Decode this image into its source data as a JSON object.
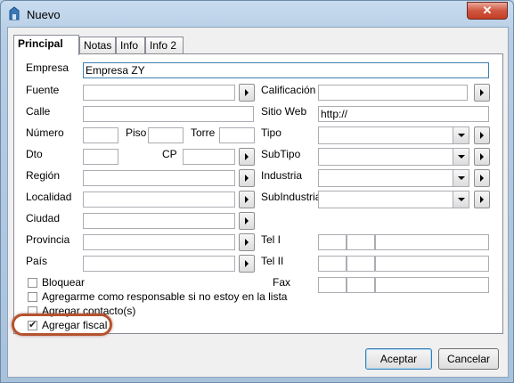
{
  "window": {
    "title": "Nuevo",
    "close_label": "✕"
  },
  "tabs": [
    {
      "label": "Principal"
    },
    {
      "label": "Notas"
    },
    {
      "label": "Info"
    },
    {
      "label": "Info 2"
    }
  ],
  "left": {
    "empresa": {
      "label": "Empresa",
      "value": "Empresa ZY"
    },
    "fuente": {
      "label": "Fuente",
      "value": ""
    },
    "calle": {
      "label": "Calle",
      "value": ""
    },
    "numero": {
      "label": "Número",
      "value": ""
    },
    "piso": {
      "label": "Piso",
      "value": ""
    },
    "torre": {
      "label": "Torre",
      "value": ""
    },
    "dto": {
      "label": "Dto",
      "value": ""
    },
    "cp": {
      "label": "CP",
      "value": ""
    },
    "region": {
      "label": "Región",
      "value": ""
    },
    "localidad": {
      "label": "Localidad",
      "value": ""
    },
    "ciudad": {
      "label": "Ciudad",
      "value": ""
    },
    "provincia": {
      "label": "Provincia",
      "value": ""
    },
    "pais": {
      "label": "País",
      "value": ""
    }
  },
  "right": {
    "calificacion": {
      "label": "Calificación",
      "value": ""
    },
    "sitio_web": {
      "label": "Sitio Web",
      "value": "http://"
    },
    "tipo": {
      "label": "Tipo",
      "value": ""
    },
    "subtipo": {
      "label": "SubTipo",
      "value": ""
    },
    "industria": {
      "label": "Industria",
      "value": ""
    },
    "subindustria": {
      "label": "SubIndustria",
      "value": ""
    },
    "tel1": {
      "label": "Tel I"
    },
    "tel2": {
      "label": "Tel II"
    },
    "fax": {
      "label": "Fax"
    }
  },
  "checkboxes": [
    {
      "label": "Bloquear",
      "checked": false
    },
    {
      "label": "Agregarme como responsable si no estoy en la lista",
      "checked": false
    },
    {
      "label": "Agregar contacto(s)",
      "checked": false
    },
    {
      "label": "Agregar fiscal",
      "checked": true
    }
  ],
  "buttons": {
    "accept": {
      "label": "Aceptar"
    },
    "cancel": {
      "label": "Cancelar"
    }
  },
  "colors": {
    "highlight": "#b5522f",
    "close": "#c33f25"
  }
}
